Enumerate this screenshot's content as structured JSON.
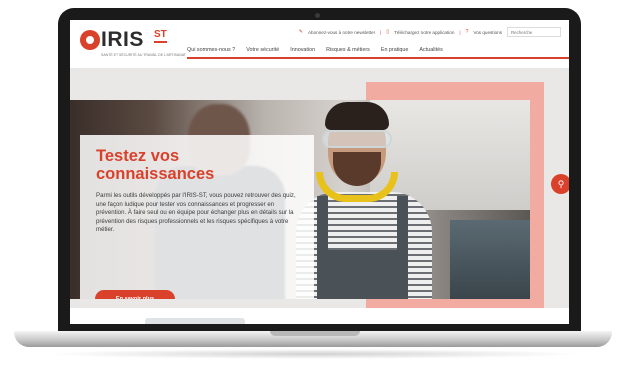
{
  "brand": {
    "logo_text": "IRIS",
    "logo_suffix": "ST",
    "tagline": "SANTÉ ET SÉCURITÉ AU TRAVAIL DE L'ARTISANAT"
  },
  "toplinks": {
    "newsletter": "Abonnez-vous à notre newsletter",
    "app": "Téléchargez notre application",
    "questions": "Vos questions",
    "separator": "|",
    "search_placeholder": "Recherche"
  },
  "nav": {
    "items": [
      "Qui sommes-nous ?",
      "Votre sécurité",
      "Innovation",
      "Risques & métiers",
      "En pratique",
      "Actualités"
    ]
  },
  "hero": {
    "title": "Testez vos connaissances",
    "body": "Parmi les outils développés par l'IRIS-ST, vous pouvez retrouver des quiz, une façon ludique pour tester vos connaissances et progresser en prévention. À faire seul ou en équipe pour échanger plus en détails sur la prévention des risques professionnels et les risques spécifiques à votre métier.",
    "button_label": "En savoir plus",
    "slides_total": 3,
    "active_slide": 2
  },
  "fab": {
    "icon": "search-icon",
    "glyph": "⚲"
  },
  "icons": {
    "pencil": "✎",
    "phone": "▯",
    "question": "?"
  },
  "colors": {
    "accent": "#d9412b",
    "pink": "#f2aba0",
    "text": "#3b3b3b"
  }
}
